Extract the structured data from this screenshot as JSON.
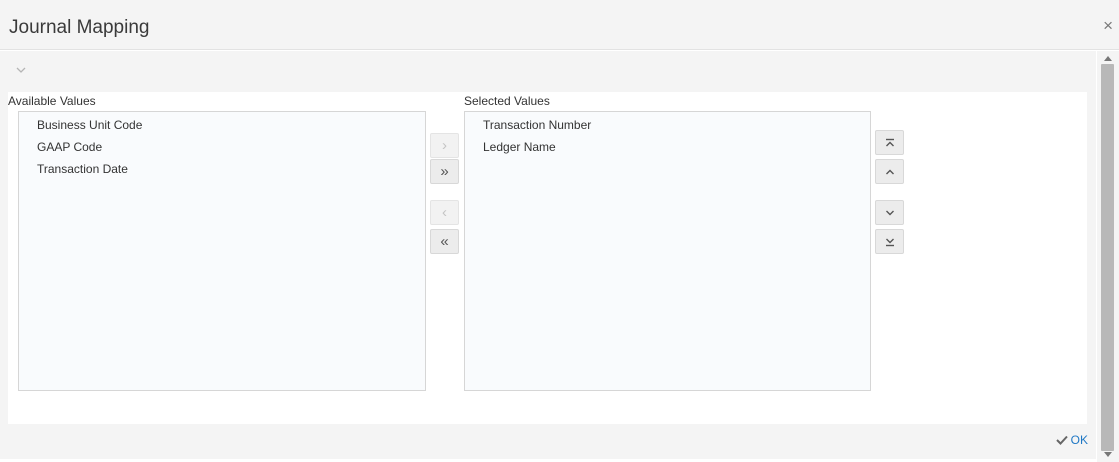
{
  "dialog": {
    "title": "Journal Mapping",
    "close_glyph": "×"
  },
  "available": {
    "label": "Available Values",
    "items": [
      "Business Unit Code",
      "GAAP Code",
      "Transaction Date"
    ]
  },
  "selected": {
    "label": "Selected Values",
    "items": [
      "Transaction Number",
      "Ledger Name"
    ]
  },
  "transfer_buttons": {
    "move_right": {
      "glyph": "›",
      "state": "disabled"
    },
    "move_all_right": {
      "glyph": "»",
      "state": "enabled"
    },
    "move_left": {
      "glyph": "‹",
      "state": "disabled"
    },
    "move_all_left": {
      "glyph": "«",
      "state": "enabled"
    }
  },
  "order_buttons": [
    "move-top-icon",
    "move-up-icon",
    "move-down-icon",
    "move-bottom-icon"
  ],
  "footer": {
    "ok_label": "OK",
    "ok_icon": "checkmark-icon"
  },
  "colors": {
    "accent": "#1f78c5",
    "header_bg": "#f4f4f4",
    "list_bg": "#f9fbfd"
  }
}
